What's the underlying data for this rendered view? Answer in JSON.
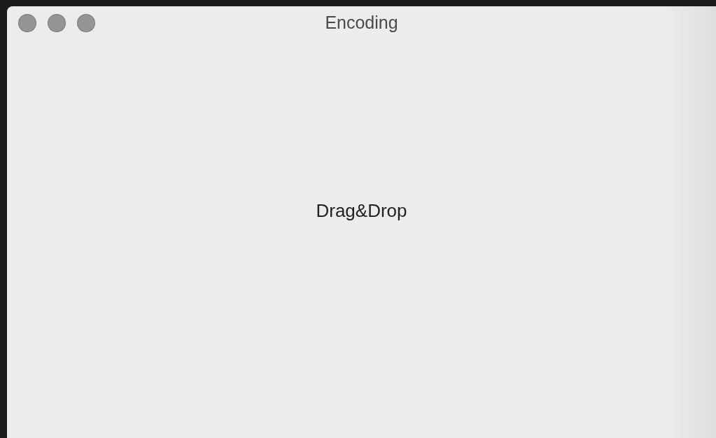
{
  "window": {
    "title": "Encoding",
    "focused": false
  },
  "drop_zone": {
    "label": "Drag&Drop"
  }
}
